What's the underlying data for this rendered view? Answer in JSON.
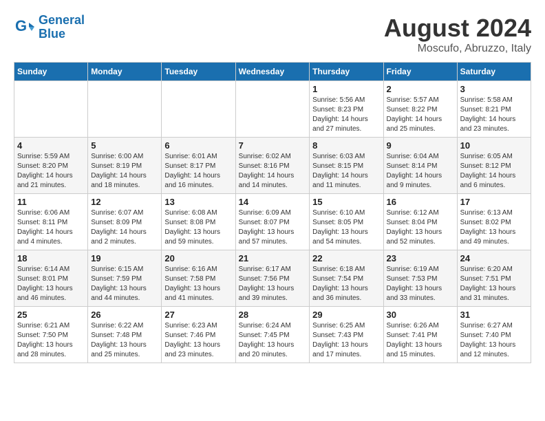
{
  "header": {
    "logo_line1": "General",
    "logo_line2": "Blue",
    "month": "August 2024",
    "location": "Moscufo, Abruzzo, Italy"
  },
  "weekdays": [
    "Sunday",
    "Monday",
    "Tuesday",
    "Wednesday",
    "Thursday",
    "Friday",
    "Saturday"
  ],
  "weeks": [
    [
      {
        "day": "",
        "info": ""
      },
      {
        "day": "",
        "info": ""
      },
      {
        "day": "",
        "info": ""
      },
      {
        "day": "",
        "info": ""
      },
      {
        "day": "1",
        "info": "Sunrise: 5:56 AM\nSunset: 8:23 PM\nDaylight: 14 hours and 27 minutes."
      },
      {
        "day": "2",
        "info": "Sunrise: 5:57 AM\nSunset: 8:22 PM\nDaylight: 14 hours and 25 minutes."
      },
      {
        "day": "3",
        "info": "Sunrise: 5:58 AM\nSunset: 8:21 PM\nDaylight: 14 hours and 23 minutes."
      }
    ],
    [
      {
        "day": "4",
        "info": "Sunrise: 5:59 AM\nSunset: 8:20 PM\nDaylight: 14 hours and 21 minutes."
      },
      {
        "day": "5",
        "info": "Sunrise: 6:00 AM\nSunset: 8:19 PM\nDaylight: 14 hours and 18 minutes."
      },
      {
        "day": "6",
        "info": "Sunrise: 6:01 AM\nSunset: 8:17 PM\nDaylight: 14 hours and 16 minutes."
      },
      {
        "day": "7",
        "info": "Sunrise: 6:02 AM\nSunset: 8:16 PM\nDaylight: 14 hours and 14 minutes."
      },
      {
        "day": "8",
        "info": "Sunrise: 6:03 AM\nSunset: 8:15 PM\nDaylight: 14 hours and 11 minutes."
      },
      {
        "day": "9",
        "info": "Sunrise: 6:04 AM\nSunset: 8:14 PM\nDaylight: 14 hours and 9 minutes."
      },
      {
        "day": "10",
        "info": "Sunrise: 6:05 AM\nSunset: 8:12 PM\nDaylight: 14 hours and 6 minutes."
      }
    ],
    [
      {
        "day": "11",
        "info": "Sunrise: 6:06 AM\nSunset: 8:11 PM\nDaylight: 14 hours and 4 minutes."
      },
      {
        "day": "12",
        "info": "Sunrise: 6:07 AM\nSunset: 8:09 PM\nDaylight: 14 hours and 2 minutes."
      },
      {
        "day": "13",
        "info": "Sunrise: 6:08 AM\nSunset: 8:08 PM\nDaylight: 13 hours and 59 minutes."
      },
      {
        "day": "14",
        "info": "Sunrise: 6:09 AM\nSunset: 8:07 PM\nDaylight: 13 hours and 57 minutes."
      },
      {
        "day": "15",
        "info": "Sunrise: 6:10 AM\nSunset: 8:05 PM\nDaylight: 13 hours and 54 minutes."
      },
      {
        "day": "16",
        "info": "Sunrise: 6:12 AM\nSunset: 8:04 PM\nDaylight: 13 hours and 52 minutes."
      },
      {
        "day": "17",
        "info": "Sunrise: 6:13 AM\nSunset: 8:02 PM\nDaylight: 13 hours and 49 minutes."
      }
    ],
    [
      {
        "day": "18",
        "info": "Sunrise: 6:14 AM\nSunset: 8:01 PM\nDaylight: 13 hours and 46 minutes."
      },
      {
        "day": "19",
        "info": "Sunrise: 6:15 AM\nSunset: 7:59 PM\nDaylight: 13 hours and 44 minutes."
      },
      {
        "day": "20",
        "info": "Sunrise: 6:16 AM\nSunset: 7:58 PM\nDaylight: 13 hours and 41 minutes."
      },
      {
        "day": "21",
        "info": "Sunrise: 6:17 AM\nSunset: 7:56 PM\nDaylight: 13 hours and 39 minutes."
      },
      {
        "day": "22",
        "info": "Sunrise: 6:18 AM\nSunset: 7:54 PM\nDaylight: 13 hours and 36 minutes."
      },
      {
        "day": "23",
        "info": "Sunrise: 6:19 AM\nSunset: 7:53 PM\nDaylight: 13 hours and 33 minutes."
      },
      {
        "day": "24",
        "info": "Sunrise: 6:20 AM\nSunset: 7:51 PM\nDaylight: 13 hours and 31 minutes."
      }
    ],
    [
      {
        "day": "25",
        "info": "Sunrise: 6:21 AM\nSunset: 7:50 PM\nDaylight: 13 hours and 28 minutes."
      },
      {
        "day": "26",
        "info": "Sunrise: 6:22 AM\nSunset: 7:48 PM\nDaylight: 13 hours and 25 minutes."
      },
      {
        "day": "27",
        "info": "Sunrise: 6:23 AM\nSunset: 7:46 PM\nDaylight: 13 hours and 23 minutes."
      },
      {
        "day": "28",
        "info": "Sunrise: 6:24 AM\nSunset: 7:45 PM\nDaylight: 13 hours and 20 minutes."
      },
      {
        "day": "29",
        "info": "Sunrise: 6:25 AM\nSunset: 7:43 PM\nDaylight: 13 hours and 17 minutes."
      },
      {
        "day": "30",
        "info": "Sunrise: 6:26 AM\nSunset: 7:41 PM\nDaylight: 13 hours and 15 minutes."
      },
      {
        "day": "31",
        "info": "Sunrise: 6:27 AM\nSunset: 7:40 PM\nDaylight: 13 hours and 12 minutes."
      }
    ]
  ]
}
